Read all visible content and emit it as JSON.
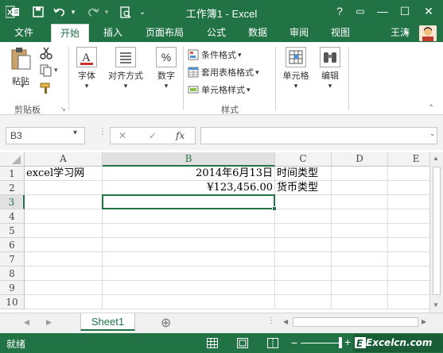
{
  "app": {
    "title": "工作簿1 - Excel",
    "user": "王涛"
  },
  "window_buttons": {
    "help": "?",
    "ribbon_display": "▭",
    "minimize": "—",
    "maximize": "☐",
    "close": "✕"
  },
  "tabs": [
    {
      "label": "文件"
    },
    {
      "label": "开始"
    },
    {
      "label": "插入"
    },
    {
      "label": "页面布局"
    },
    {
      "label": "公式"
    },
    {
      "label": "数据"
    },
    {
      "label": "审阅"
    },
    {
      "label": "视图"
    }
  ],
  "ribbon": {
    "paste": "粘贴",
    "clipboard_group": "剪贴板",
    "font": "字体",
    "alignment": "对齐方式",
    "number": "数字",
    "number_symbol": "%",
    "conditional_format": "条件格式",
    "table_format": "套用表格格式",
    "cell_styles": "单元格样式",
    "styles_group": "样式",
    "cells": "单元格",
    "editing": "编辑"
  },
  "formula_bar": {
    "name_box": "B3",
    "fx": "fx",
    "cancel": "✕",
    "enter": "✓",
    "value": ""
  },
  "columns": [
    "A",
    "B",
    "C",
    "D",
    "E"
  ],
  "rows": [
    "1",
    "2",
    "3",
    "4",
    "5",
    "6",
    "7",
    "8",
    "9",
    "10"
  ],
  "cells": {
    "A1": "excel学习网",
    "B1": "2014年6月13日",
    "C1": "时间类型",
    "B2": "¥123,456.00",
    "C2": "货币类型"
  },
  "selected_cell": "B3",
  "sheet": {
    "name": "Sheet1",
    "add": "⊕"
  },
  "status": {
    "text": "就绪",
    "zoom_plus": "+",
    "watermark": "Excelcn.com"
  },
  "colors": {
    "accent": "#217346",
    "grid": "#dadcdd"
  }
}
